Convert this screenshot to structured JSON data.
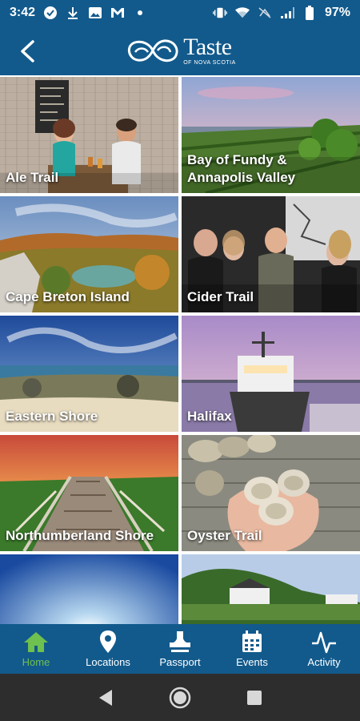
{
  "status_bar": {
    "time": "3:42",
    "battery_percent": "97%",
    "left_icons": [
      "vpn-check-icon",
      "download-icon",
      "image-icon",
      "gmail-icon",
      "dot-icon"
    ],
    "right_icons": [
      "vibrate-icon",
      "wifi-icon",
      "no-data-icon",
      "signal-icon",
      "battery-icon"
    ]
  },
  "header": {
    "logo_word": "Taste",
    "logo_sub": "OF NOVA SCOTIA",
    "back_icon": "chevron-left-icon"
  },
  "tiles": [
    {
      "label": "Ale Trail",
      "scene": "ale"
    },
    {
      "label": "Bay of Fundy & Annapolis Valley",
      "scene": "fundy"
    },
    {
      "label": "Cape Breton Island",
      "scene": "capebreton"
    },
    {
      "label": "Cider Trail",
      "scene": "cider"
    },
    {
      "label": "Eastern Shore",
      "scene": "eastern"
    },
    {
      "label": "Halifax",
      "scene": "halifax"
    },
    {
      "label": "Northumberland Shore",
      "scene": "northumberland"
    },
    {
      "label": "Oyster Trail",
      "scene": "oyster"
    },
    {
      "label": "",
      "scene": "sky"
    },
    {
      "label": "",
      "scene": "hills"
    }
  ],
  "bottom_nav": [
    {
      "label": "Home",
      "icon": "home-icon",
      "active": true
    },
    {
      "label": "Locations",
      "icon": "map-pin-icon",
      "active": false
    },
    {
      "label": "Passport",
      "icon": "stamp-icon",
      "active": false
    },
    {
      "label": "Events",
      "icon": "calendar-icon",
      "active": false
    },
    {
      "label": "Activity",
      "icon": "activity-icon",
      "active": false
    }
  ],
  "colors": {
    "brand_blue": "#125a8c",
    "active_green": "#6ec04f",
    "system_nav": "#2d2d2d"
  }
}
